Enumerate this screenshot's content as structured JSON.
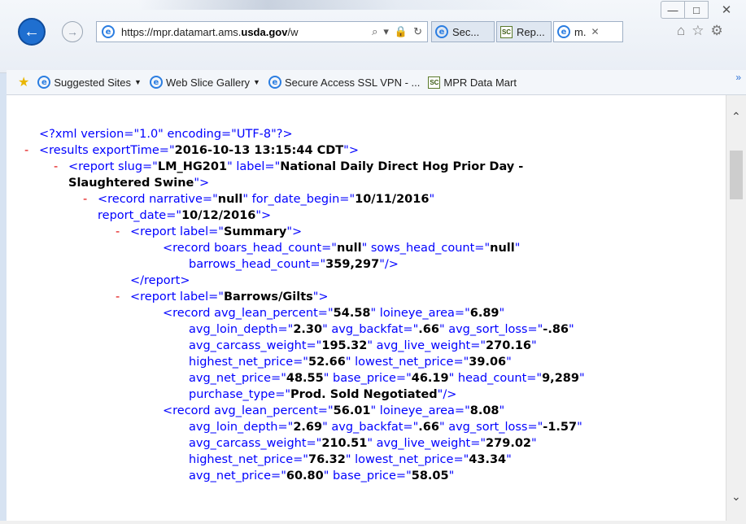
{
  "window": {
    "min_glyph": "—",
    "max_glyph": "□",
    "close_glyph": "✕"
  },
  "nav": {
    "back_glyph": "←",
    "forward_glyph": "→"
  },
  "address": {
    "url_prefix": "https://mpr.datamart.ams.",
    "url_domain": "usda.gov",
    "url_suffix": "/w",
    "search_glyph": "⌕",
    "dropdown_glyph": "▾",
    "lock_glyph": "🔒",
    "refresh_glyph": "↻"
  },
  "tabs": [
    {
      "label": "Sec..."
    },
    {
      "label": "Rep..."
    },
    {
      "label": "m.",
      "close": "✕"
    }
  ],
  "toolbar_icons": {
    "home": "⌂",
    "favorites": "☆",
    "settings": "⚙"
  },
  "favorites_bar": {
    "items": [
      {
        "label": "Suggested Sites"
      },
      {
        "label": "Web Slice Gallery"
      },
      {
        "label": "Secure Access SSL VPN - ..."
      },
      {
        "label": "MPR Data Mart"
      }
    ],
    "more": "»"
  },
  "icons": {
    "ie": "e",
    "mpr": "SC",
    "star": "★",
    "caret": "▼"
  },
  "xml": {
    "dash": "-",
    "lines": [
      {
        "indent": 40,
        "dash": false,
        "segments": [
          {
            "t": "<?xml version=\"1.0\" encoding=\"UTF-8\"?>",
            "c": "pi"
          }
        ]
      },
      {
        "indent": 40,
        "dash": true,
        "segments": [
          {
            "t": "<results exportTime=\"",
            "c": "tag"
          },
          {
            "t": "2016-10-13 13:15:44 CDT",
            "c": "val"
          },
          {
            "t": "\">",
            "c": "tag"
          }
        ]
      },
      {
        "indent": 76,
        "dash": true,
        "segments": [
          {
            "t": "<report slug=\"",
            "c": "tag"
          },
          {
            "t": "LM_HG201",
            "c": "val"
          },
          {
            "t": "\" label=\"",
            "c": "tag"
          },
          {
            "t": "National Daily Direct Hog Prior Day -",
            "c": "val"
          }
        ]
      },
      {
        "indent": 76,
        "dash": false,
        "segments": [
          {
            "t": "Slaughtered Swine",
            "c": "val"
          },
          {
            "t": "\">",
            "c": "tag"
          }
        ]
      },
      {
        "indent": 112,
        "dash": true,
        "segments": [
          {
            "t": "<record narrative=\"",
            "c": "tag"
          },
          {
            "t": "null",
            "c": "val"
          },
          {
            "t": "\" for_date_begin=\"",
            "c": "tag"
          },
          {
            "t": "10/11/2016",
            "c": "val"
          },
          {
            "t": "\"",
            "c": "tag"
          }
        ]
      },
      {
        "indent": 112,
        "dash": false,
        "segments": [
          {
            "t": "report_date=\"",
            "c": "tag"
          },
          {
            "t": "10/12/2016",
            "c": "val"
          },
          {
            "t": "\">",
            "c": "tag"
          }
        ]
      },
      {
        "indent": 152,
        "dash": true,
        "segments": [
          {
            "t": "<report label=\"",
            "c": "tag"
          },
          {
            "t": "Summary",
            "c": "val"
          },
          {
            "t": "\">",
            "c": "tag"
          }
        ]
      },
      {
        "indent": 192,
        "dash": false,
        "segments": [
          {
            "t": "<record boars_head_count=\"",
            "c": "tag"
          },
          {
            "t": "null",
            "c": "val"
          },
          {
            "t": "\" sows_head_count=\"",
            "c": "tag"
          },
          {
            "t": "null",
            "c": "val"
          },
          {
            "t": "\"",
            "c": "tag"
          }
        ]
      },
      {
        "indent": 224,
        "dash": false,
        "segments": [
          {
            "t": "barrows_head_count=\"",
            "c": "tag"
          },
          {
            "t": "359,297",
            "c": "val"
          },
          {
            "t": "\"/>",
            "c": "tag"
          }
        ]
      },
      {
        "indent": 152,
        "dash": false,
        "segments": [
          {
            "t": "</report>",
            "c": "tag"
          }
        ]
      },
      {
        "indent": 152,
        "dash": true,
        "segments": [
          {
            "t": "<report label=\"",
            "c": "tag"
          },
          {
            "t": "Barrows/Gilts",
            "c": "val"
          },
          {
            "t": "\">",
            "c": "tag"
          }
        ]
      },
      {
        "indent": 192,
        "dash": false,
        "segments": [
          {
            "t": "<record avg_lean_percent=\"",
            "c": "tag"
          },
          {
            "t": "54.58",
            "c": "val"
          },
          {
            "t": "\" loineye_area=\"",
            "c": "tag"
          },
          {
            "t": "6.89",
            "c": "val"
          },
          {
            "t": "\"",
            "c": "tag"
          }
        ]
      },
      {
        "indent": 224,
        "dash": false,
        "segments": [
          {
            "t": "avg_loin_depth=\"",
            "c": "tag"
          },
          {
            "t": "2.30",
            "c": "val"
          },
          {
            "t": "\" avg_backfat=\"",
            "c": "tag"
          },
          {
            "t": ".66",
            "c": "val"
          },
          {
            "t": "\" avg_sort_loss=\"",
            "c": "tag"
          },
          {
            "t": "-.86",
            "c": "val"
          },
          {
            "t": "\"",
            "c": "tag"
          }
        ]
      },
      {
        "indent": 224,
        "dash": false,
        "segments": [
          {
            "t": "avg_carcass_weight=\"",
            "c": "tag"
          },
          {
            "t": "195.32",
            "c": "val"
          },
          {
            "t": "\" avg_live_weight=\"",
            "c": "tag"
          },
          {
            "t": "270.16",
            "c": "val"
          },
          {
            "t": "\"",
            "c": "tag"
          }
        ]
      },
      {
        "indent": 224,
        "dash": false,
        "segments": [
          {
            "t": "highest_net_price=\"",
            "c": "tag"
          },
          {
            "t": "52.66",
            "c": "val"
          },
          {
            "t": "\" lowest_net_price=\"",
            "c": "tag"
          },
          {
            "t": "39.06",
            "c": "val"
          },
          {
            "t": "\"",
            "c": "tag"
          }
        ]
      },
      {
        "indent": 224,
        "dash": false,
        "segments": [
          {
            "t": "avg_net_price=\"",
            "c": "tag"
          },
          {
            "t": "48.55",
            "c": "val"
          },
          {
            "t": "\" base_price=\"",
            "c": "tag"
          },
          {
            "t": "46.19",
            "c": "val"
          },
          {
            "t": "\" head_count=\"",
            "c": "tag"
          },
          {
            "t": "9,289",
            "c": "val"
          },
          {
            "t": "\"",
            "c": "tag"
          }
        ]
      },
      {
        "indent": 224,
        "dash": false,
        "segments": [
          {
            "t": "purchase_type=\"",
            "c": "tag"
          },
          {
            "t": "Prod. Sold Negotiated",
            "c": "val"
          },
          {
            "t": "\"/>",
            "c": "tag"
          }
        ]
      },
      {
        "indent": 192,
        "dash": false,
        "segments": [
          {
            "t": "<record avg_lean_percent=\"",
            "c": "tag"
          },
          {
            "t": "56.01",
            "c": "val"
          },
          {
            "t": "\" loineye_area=\"",
            "c": "tag"
          },
          {
            "t": "8.08",
            "c": "val"
          },
          {
            "t": "\"",
            "c": "tag"
          }
        ]
      },
      {
        "indent": 224,
        "dash": false,
        "segments": [
          {
            "t": "avg_loin_depth=\"",
            "c": "tag"
          },
          {
            "t": "2.69",
            "c": "val"
          },
          {
            "t": "\" avg_backfat=\"",
            "c": "tag"
          },
          {
            "t": ".66",
            "c": "val"
          },
          {
            "t": "\" avg_sort_loss=\"",
            "c": "tag"
          },
          {
            "t": "-1.57",
            "c": "val"
          },
          {
            "t": "\"",
            "c": "tag"
          }
        ]
      },
      {
        "indent": 224,
        "dash": false,
        "segments": [
          {
            "t": "avg_carcass_weight=\"",
            "c": "tag"
          },
          {
            "t": "210.51",
            "c": "val"
          },
          {
            "t": "\" avg_live_weight=\"",
            "c": "tag"
          },
          {
            "t": "279.02",
            "c": "val"
          },
          {
            "t": "\"",
            "c": "tag"
          }
        ]
      },
      {
        "indent": 224,
        "dash": false,
        "segments": [
          {
            "t": "highest_net_price=\"",
            "c": "tag"
          },
          {
            "t": "76.32",
            "c": "val"
          },
          {
            "t": "\" lowest_net_price=\"",
            "c": "tag"
          },
          {
            "t": "43.34",
            "c": "val"
          },
          {
            "t": "\"",
            "c": "tag"
          }
        ]
      },
      {
        "indent": 224,
        "dash": false,
        "segments": [
          {
            "t": "avg_net_price=\"",
            "c": "tag"
          },
          {
            "t": "60.80",
            "c": "val"
          },
          {
            "t": "\" base_price=\"",
            "c": "tag"
          },
          {
            "t": "58.05",
            "c": "val"
          },
          {
            "t": "\"",
            "c": "tag"
          }
        ]
      }
    ]
  },
  "scrollbar": {
    "up": "⌃",
    "down": "⌄"
  }
}
